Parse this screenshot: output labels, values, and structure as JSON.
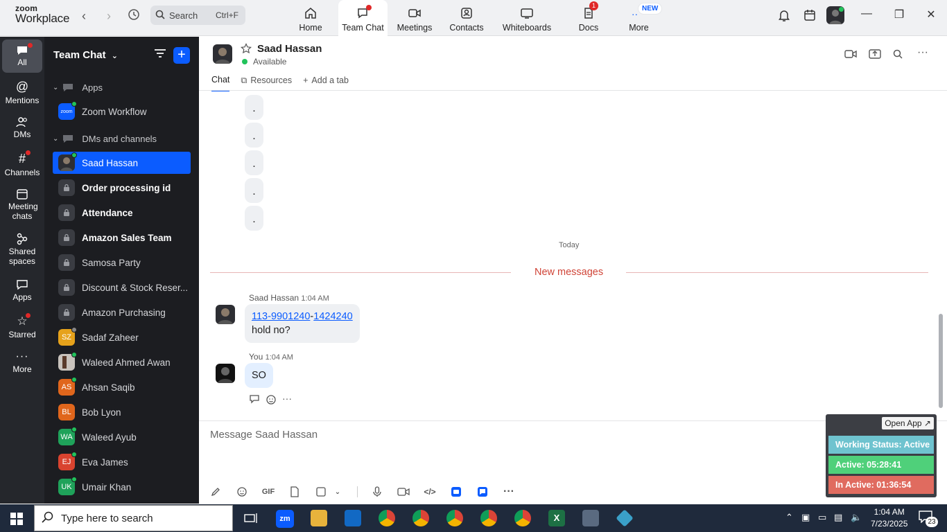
{
  "app": {
    "logo_line1": "zoom",
    "logo_line2": "Workplace",
    "search_placeholder": "Search",
    "search_shortcut": "Ctrl+F",
    "tabs": [
      {
        "label": "Home",
        "icon": "home-icon"
      },
      {
        "label": "Team Chat",
        "icon": "chat-icon",
        "active": true
      },
      {
        "label": "Meetings",
        "icon": "video-icon"
      },
      {
        "label": "Contacts",
        "icon": "contacts-icon"
      },
      {
        "label": "Whiteboards",
        "icon": "whiteboard-icon"
      },
      {
        "label": "Docs",
        "icon": "docs-icon",
        "badge": "1"
      },
      {
        "label": "More",
        "icon": "more-icon",
        "badge": "NEW"
      }
    ]
  },
  "rail": {
    "items": [
      {
        "label": "All",
        "icon": "chat-bubble-icon",
        "active": true
      },
      {
        "label": "Mentions",
        "icon": "at-icon"
      },
      {
        "label": "DMs",
        "icon": "people-icon"
      },
      {
        "label": "Channels",
        "icon": "hash-icon"
      },
      {
        "label": "Meeting chats",
        "icon": "calendar-icon"
      },
      {
        "label": "Shared spaces",
        "icon": "share-icon"
      },
      {
        "label": "Apps",
        "icon": "apps-icon"
      },
      {
        "label": "Starred",
        "icon": "star-icon"
      },
      {
        "label": "More",
        "icon": "ellipsis-icon"
      }
    ]
  },
  "sidebar": {
    "title": "Team Chat",
    "section_apps": "Apps",
    "app_item": "Zoom Workflow",
    "app_avatar": "zoom",
    "section_dms": "DMs and channels",
    "items": [
      {
        "label": "Saad Hassan",
        "selected": true
      },
      {
        "label": "Order processing id",
        "bold": true
      },
      {
        "label": "Attendance",
        "bold": true
      },
      {
        "label": "Amazon Sales Team",
        "bold": true
      },
      {
        "label": "Samosa Party"
      },
      {
        "label": "Discount & Stock Reser..."
      },
      {
        "label": "Amazon Purchasing"
      },
      {
        "label": "Sadaf Zaheer",
        "initials": "SZ"
      },
      {
        "label": "Waleed Ahmed Awan"
      },
      {
        "label": "Ahsan Saqib",
        "initials": "AS"
      },
      {
        "label": "Bob Lyon",
        "initials": "BL"
      },
      {
        "label": "Waleed Ayub",
        "initials": "WA"
      },
      {
        "label": "Eva James",
        "initials": "EJ"
      },
      {
        "label": "Umair Khan",
        "initials": "UK"
      }
    ]
  },
  "chat": {
    "contact_name": "Saad Hassan",
    "status": "Available",
    "tabs": [
      "Chat",
      "Resources",
      "Add a tab"
    ],
    "dots": [
      ".",
      ".",
      ".",
      ".",
      "."
    ],
    "date_label": "Today",
    "new_messages_label": "New messages",
    "messages": [
      {
        "sender": "Saad Hassan",
        "time": "1:04 AM",
        "link1": " 113-9901240",
        "sep": "-",
        "link2": "1424240",
        "line2": "hold no?"
      },
      {
        "sender": "You",
        "time": "1:04 AM",
        "text": "SO"
      }
    ],
    "composer_placeholder": "Message Saad Hassan",
    "gif_label": "GIF"
  },
  "widget": {
    "open_label": "Open App ↗",
    "working_status": "Working Status: Active",
    "active": "Active: 05:28:41",
    "inactive": "In Active: 01:36:54"
  },
  "taskbar": {
    "search_text": "Type here to search",
    "time": "1:04 AM",
    "date": "7/23/2025",
    "notifications": "23"
  },
  "colors": {
    "accent": "#0b5cff",
    "sidebar_bg": "#1c1d21",
    "rail_bg": "#25272c",
    "widget_status": "#6fc3cf",
    "widget_active": "#4fd07a",
    "widget_inactive": "#e06b5f"
  }
}
